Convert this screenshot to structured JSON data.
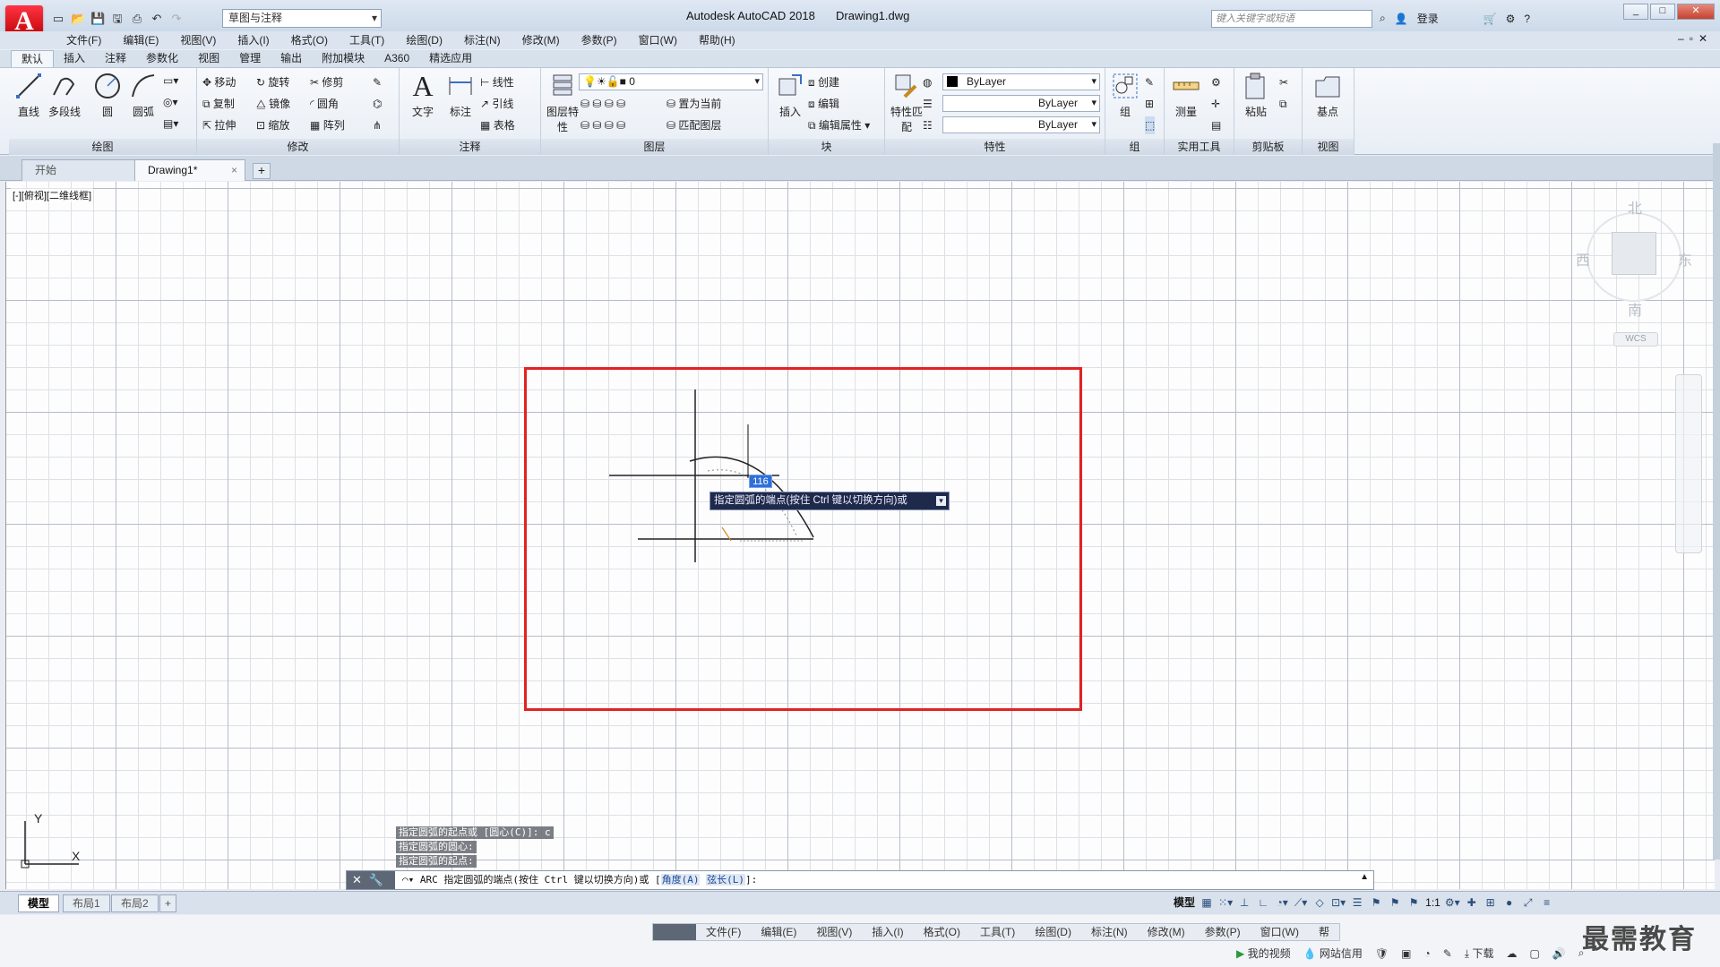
{
  "app": {
    "title": "Autodesk AutoCAD 2018",
    "file": "Drawing1.dwg",
    "logo_letter": "A",
    "workspace": "草图与注释",
    "search_placeholder": "键入关键字或短语",
    "login": "登录",
    "help": "?"
  },
  "menu": [
    "文件(F)",
    "编辑(E)",
    "视图(V)",
    "插入(I)",
    "格式(O)",
    "工具(T)",
    "绘图(D)",
    "标注(N)",
    "修改(M)",
    "参数(P)",
    "窗口(W)",
    "帮助(H)"
  ],
  "ribbon_tabs": [
    "默认",
    "插入",
    "注释",
    "参数化",
    "视图",
    "管理",
    "输出",
    "附加模块",
    "A360",
    "精选应用"
  ],
  "ribbon": {
    "draw": {
      "title": "绘图",
      "line": "直线",
      "polyline": "多段线",
      "circle": "圆",
      "arc": "圆弧"
    },
    "modify": {
      "title": "修改",
      "move": "移动",
      "rotate": "旋转",
      "trim": "修剪",
      "copy": "复制",
      "mirror": "镜像",
      "fillet": "圆角",
      "stretch": "拉伸",
      "scale": "缩放",
      "array": "阵列"
    },
    "annotate": {
      "title": "注释",
      "text": "文字",
      "dimension": "标注",
      "linear": "线性",
      "leader": "引线",
      "table": "表格"
    },
    "layers": {
      "title": "图层",
      "layer_props": "图层特性",
      "current_layer": "0",
      "set_current": "置为当前",
      "match_layer": "匹配图层"
    },
    "block": {
      "title": "块",
      "insert": "插入",
      "create": "创建",
      "edit": "编辑",
      "edit_attr": "编辑属性"
    },
    "properties": {
      "title": "特性",
      "match": "特性匹配",
      "color": "ByLayer",
      "linetype": "ByLayer",
      "lineweight": "ByLayer"
    },
    "groups": {
      "title": "组",
      "group": "组"
    },
    "utilities": {
      "title": "实用工具",
      "measure": "测量"
    },
    "clipboard": {
      "title": "剪贴板",
      "paste": "粘贴"
    },
    "view": {
      "title": "视图",
      "base": "基点"
    }
  },
  "doc_tabs": {
    "start": "开始",
    "current": "Drawing1*",
    "close": "×",
    "add": "+"
  },
  "viewport_label": "[-][俯视][二维线框]",
  "viewcube": {
    "north": "北",
    "south": "南",
    "east": "东",
    "west": "西",
    "wcs": "WCS"
  },
  "dynamic_input": {
    "value": "116",
    "prompt": "指定圆弧的端点(按住 Ctrl 键以切换方向)或"
  },
  "command_history": [
    "指定圆弧的起点或 [圆心(C)]: c",
    "指定圆弧的圆心:",
    "指定圆弧的起点:"
  ],
  "command_line": {
    "prefix": "ARC 指定圆弧的端点(按住 Ctrl 键以切换方向)或 [",
    "opt1": "角度(A)",
    "opt2": "弦长(L)",
    "suffix": "]:"
  },
  "ucs": {
    "x": "X",
    "y": "Y"
  },
  "layout_tabs": [
    "模型",
    "布局1",
    "布局2"
  ],
  "status": {
    "model": "模型",
    "scale": "1:1"
  },
  "lower_menu": [
    "文件(F)",
    "编辑(E)",
    "视图(V)",
    "插入(I)",
    "格式(O)",
    "工具(T)",
    "绘图(D)",
    "标注(N)",
    "修改(M)",
    "参数(P)",
    "窗口(W)",
    "帮"
  ],
  "tray": {
    "video": "我的视频",
    "credit": "网站信用",
    "download": "下载"
  },
  "watermark": "最需教育",
  "colors": {
    "highlight_rect": "#e12323",
    "tooltip_bg": "#1f2a4b",
    "input_bg": "#2f6fd8"
  }
}
